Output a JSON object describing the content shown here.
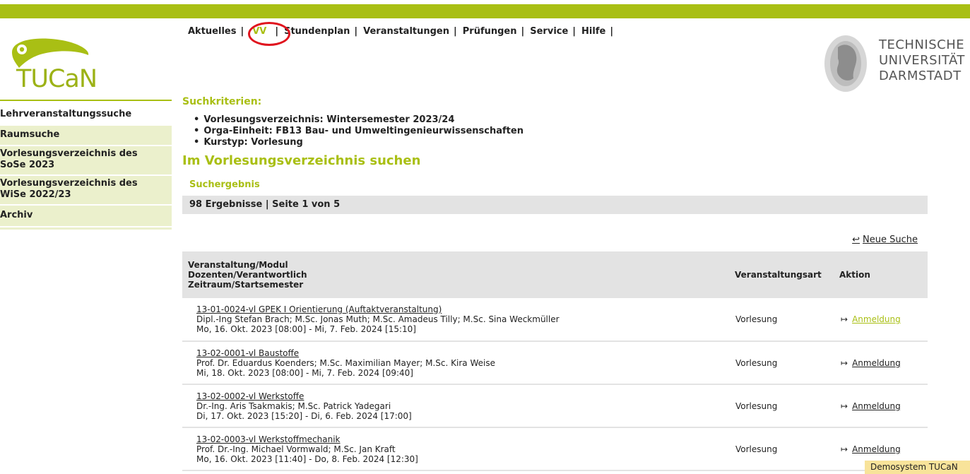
{
  "app": {
    "logo_text": "TUCaN",
    "brand_color": "#a9bf14"
  },
  "nav": {
    "items": [
      {
        "label": "Aktuelles"
      },
      {
        "label": "VV"
      },
      {
        "label": "Stundenplan"
      },
      {
        "label": "Veranstaltungen"
      },
      {
        "label": "Prüfungen"
      },
      {
        "label": "Service"
      },
      {
        "label": "Hilfe"
      }
    ],
    "separator": "|"
  },
  "university": {
    "line1": "TECHNISCHE",
    "line2": "UNIVERSITÄT",
    "line3": "DARMSTADT"
  },
  "sidebar": {
    "items": [
      {
        "label": "Lehrveranstaltungssuche"
      },
      {
        "label": "Raumsuche"
      },
      {
        "label": "Vorlesungsverzeichnis des SoSe 2023"
      },
      {
        "label": "Vorlesungsverzeichnis des WiSe 2022/23"
      },
      {
        "label": "Archiv"
      }
    ]
  },
  "main": {
    "criteria_heading": "Suchkriterien:",
    "criteria": [
      "Vorlesungsverzeichnis: Wintersemester 2023/24",
      "Orga-Einheit: FB13 Bau- und Umweltingenieurwissenschaften",
      "Kurstyp: Vorlesung"
    ],
    "page_title": "Im Vorlesungsverzeichnis suchen",
    "results_heading": "Suchergebnis",
    "results_count": "98 Ergebnisse | Seite 1 von 5",
    "new_search_label": "Neue Suche"
  },
  "table": {
    "headers": {
      "col1_line1": "Veranstaltung/Modul",
      "col1_line2": "Dozenten/Verantwortlich",
      "col1_line3": "Zeitraum/Startsemester",
      "col2": "Veranstaltungsart",
      "col3": "Aktion"
    },
    "rows": [
      {
        "title": "13-01-0024-vl GPEK I Orientierung (Auftaktveranstaltung)",
        "lecturers": "Dipl.-Ing Stefan Brach; M.Sc. Jonas Muth; M.Sc. Amadeus Tilly; M.Sc. Sina Weckmüller",
        "period": "Mo, 16. Okt. 2023 [08:00] - Mi, 7. Feb. 2024 [15:10]",
        "type": "Vorlesung",
        "action": "Anmeldung"
      },
      {
        "title": "13-02-0001-vl Baustoffe",
        "lecturers": "Prof. Dr. Eduardus Koenders; M.Sc. Maximilian Mayer; M.Sc. Kira Weise",
        "period": "Mi, 18. Okt. 2023 [08:00] - Mi, 7. Feb. 2024 [09:40]",
        "type": "Vorlesung",
        "action": "Anmeldung"
      },
      {
        "title": "13-02-0002-vl Werkstoffe",
        "lecturers": "Dr.-Ing. Aris Tsakmakis; M.Sc. Patrick Yadegari",
        "period": "Di, 17. Okt. 2023 [15:20] - Di, 6. Feb. 2024 [17:00]",
        "type": "Vorlesung",
        "action": "Anmeldung"
      },
      {
        "title": "13-02-0003-vl Werkstoffmechanik",
        "lecturers": "Prof. Dr.-Ing. Michael Vormwald; M.Sc. Jan Kraft",
        "period": "Mo, 16. Okt. 2023 [11:40] - Do, 8. Feb. 2024 [12:30]",
        "type": "Vorlesung",
        "action": "Anmeldung"
      }
    ]
  },
  "tooltip": "Demosystem TUCaN"
}
